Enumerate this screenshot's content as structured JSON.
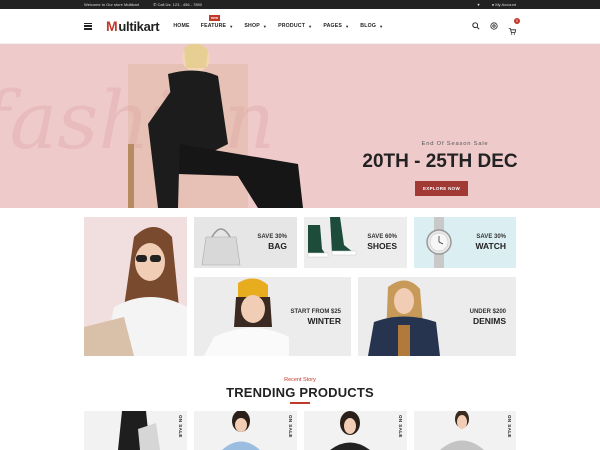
{
  "topbar": {
    "welcome": "Welcome to Our store Multikart",
    "call": "Call Us: 123 - 456 - 7890",
    "account": "My Account"
  },
  "logo": {
    "mark": "M",
    "text": "ultikart"
  },
  "menu": [
    {
      "label": "HOME"
    },
    {
      "label": "FEATURE",
      "badge": "new"
    },
    {
      "label": "SHOP"
    },
    {
      "label": "PRODUCT"
    },
    {
      "label": "PAGES"
    },
    {
      "label": "BLOG"
    }
  ],
  "cart": {
    "count": "0"
  },
  "hero": {
    "subtitle": "End Of Season Sale",
    "title": "20TH - 25TH DEC",
    "button": "EXPLORE NOW",
    "script": "fashion"
  },
  "tiles": {
    "bag": {
      "line1": "SAVE 30%",
      "line2": "BAG"
    },
    "shoes": {
      "line1": "SAVE 60%",
      "line2": "SHOES"
    },
    "watch": {
      "line1": "SAVE 30%",
      "line2": "WATCH"
    },
    "winter": {
      "line1": "START FROM $25",
      "line2": "WINTER"
    },
    "denims": {
      "line1": "UNDER $200",
      "line2": "DENIMS"
    }
  },
  "trending": {
    "sub": "Recent Story",
    "title": "TRENDING PRODUCTS"
  },
  "products": [
    {
      "tag": "ON SALE"
    },
    {
      "tag": "ON SALE"
    },
    {
      "tag": "ON SALE"
    },
    {
      "tag": "ON SALE"
    }
  ]
}
